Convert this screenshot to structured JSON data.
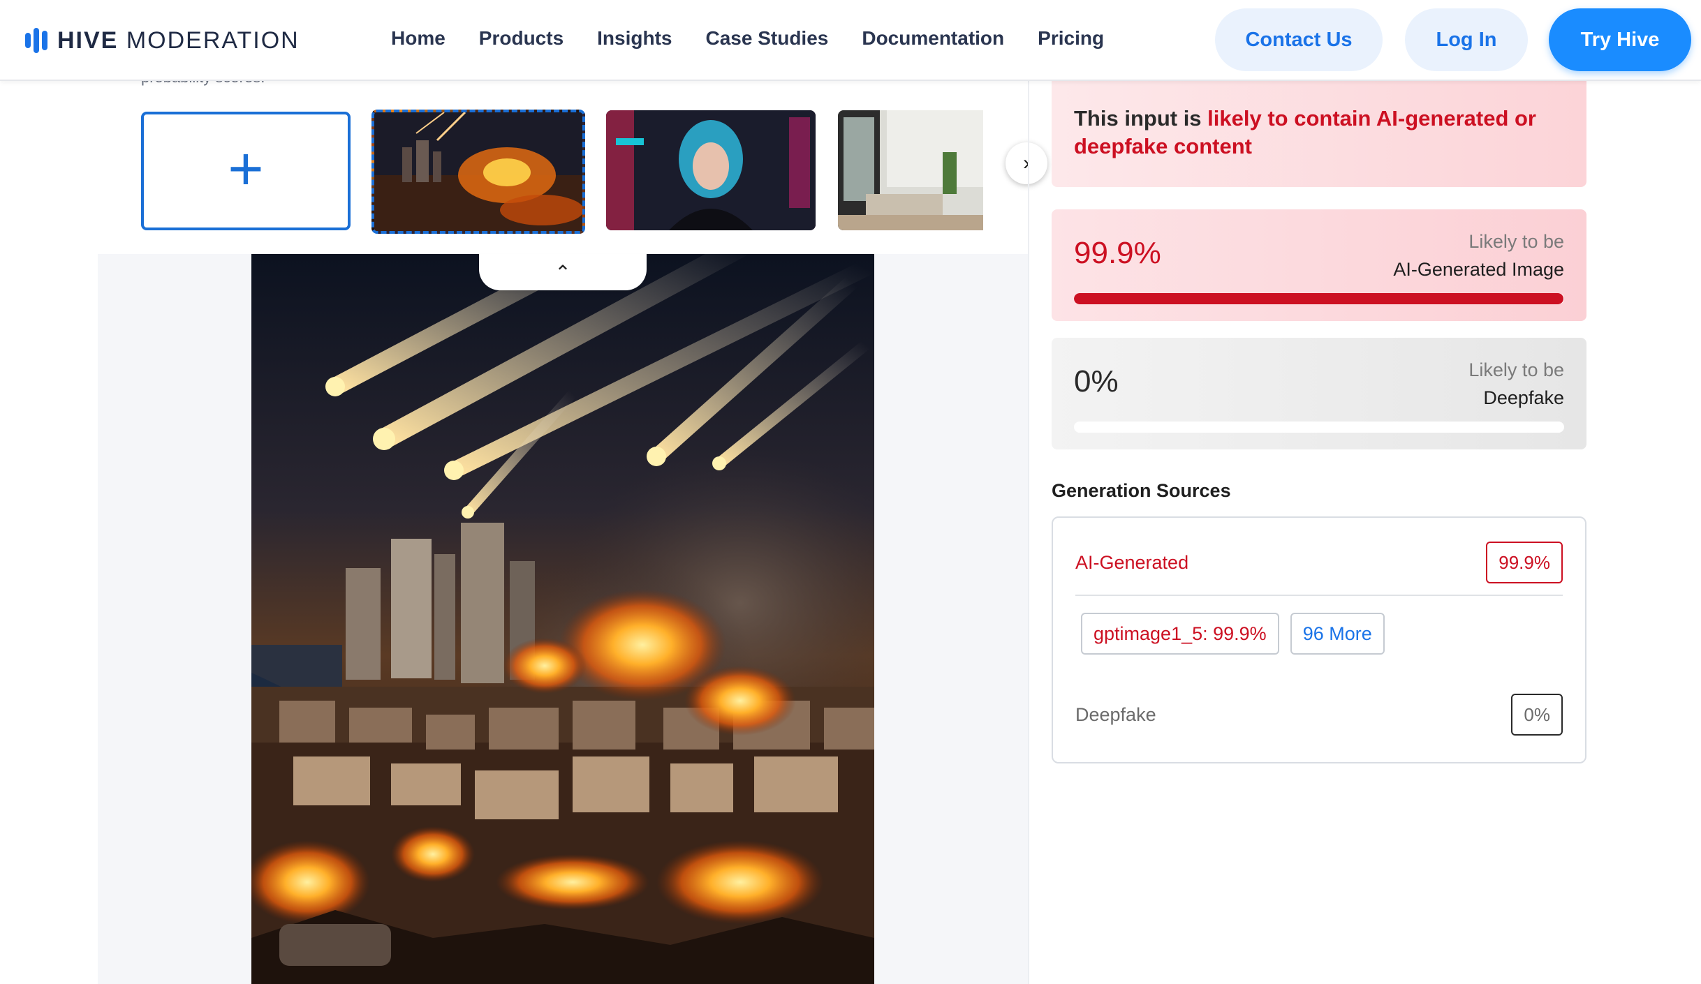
{
  "brand": {
    "bold": "HIVE",
    "light": "MODERATION",
    "accent": "#1a73e8"
  },
  "nav": [
    "Home",
    "Products",
    "Insights",
    "Case Studies",
    "Documentation",
    "Pricing"
  ],
  "actions": {
    "contact": "Contact Us",
    "login": "Log In",
    "try": "Try Hive"
  },
  "left": {
    "cut_off_text": "probability scores.",
    "thumbnails": [
      {
        "name": "add-image",
        "icon": "plus-icon"
      },
      {
        "name": "city-missile-strike",
        "selected": true
      },
      {
        "name": "neon-cyberpunk-woman"
      },
      {
        "name": "modern-living-room"
      }
    ],
    "preview_alt": "City skyline burning at night under incoming missiles"
  },
  "result": {
    "banner_prefix": "This input is ",
    "banner_highlight": "likely to contain AI-generated or deepfake content",
    "ai": {
      "value": "99.9%",
      "label_top": "Likely to be",
      "label_bottom": "AI-Generated Image",
      "fill": 0.999
    },
    "deepfake": {
      "value": "0%",
      "label_top": "Likely to be",
      "label_bottom": "Deepfake",
      "fill": 0
    }
  },
  "generation": {
    "title": "Generation Sources",
    "ai_label": "AI-Generated",
    "ai_value": "99.9%",
    "model_tag": "gptimage1_5: 99.9%",
    "more_tag": "96 More",
    "deepfake_label": "Deepfake",
    "deepfake_value": "0%"
  },
  "colors": {
    "danger": "#cc1022",
    "primary": "#1a8cff"
  }
}
